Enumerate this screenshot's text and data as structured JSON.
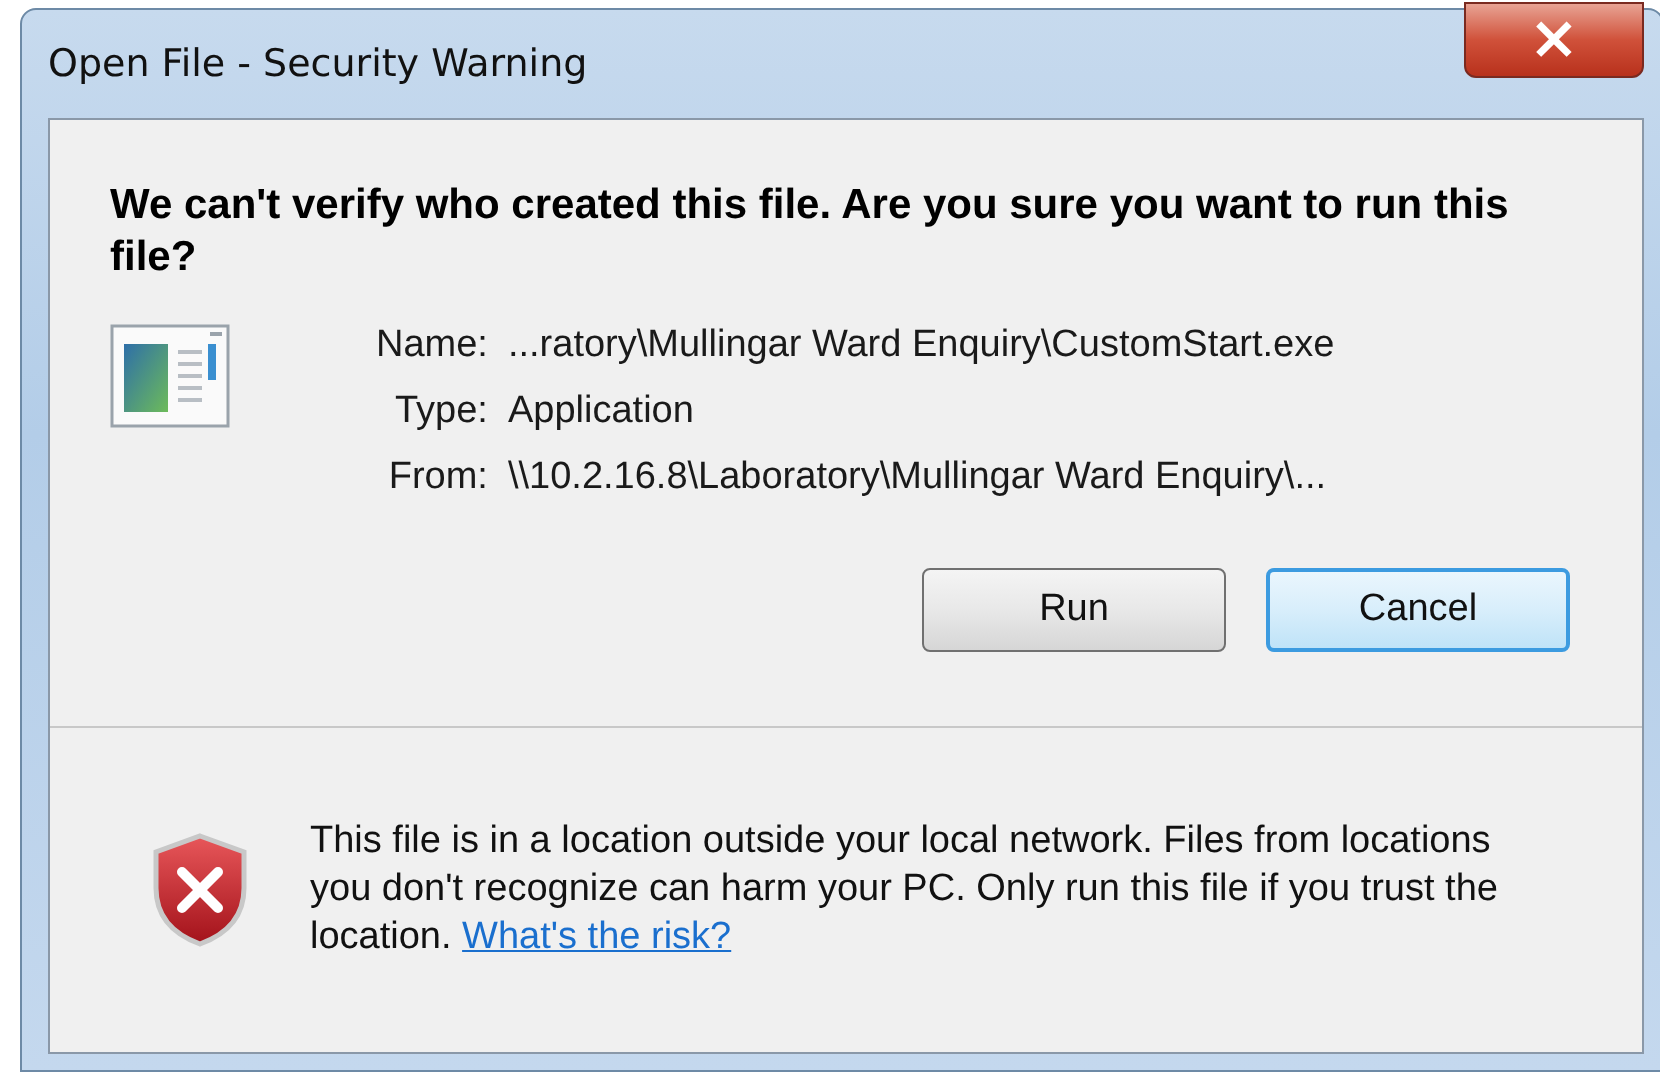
{
  "window": {
    "title": "Open File - Security Warning",
    "close": "×"
  },
  "headline": "We can't verify who created this file. Are you sure you want to run this file?",
  "details": [
    {
      "label": "Name:",
      "value": "...ratory\\Mullingar Ward Enquiry\\CustomStart.exe"
    },
    {
      "label": "Type:",
      "value": "Application"
    },
    {
      "label": "From:",
      "value": "\\\\10.2.16.8\\Laboratory\\Mullingar Ward Enquiry\\..."
    }
  ],
  "buttons": [
    {
      "label": "Run",
      "default": false
    },
    {
      "label": "Cancel",
      "default": true
    }
  ],
  "warning": {
    "text": "This file is in a location outside your local network. Files from locations you don't recognize can harm your PC. Only run this file if you trust the location.",
    "link": "What's the risk?"
  }
}
